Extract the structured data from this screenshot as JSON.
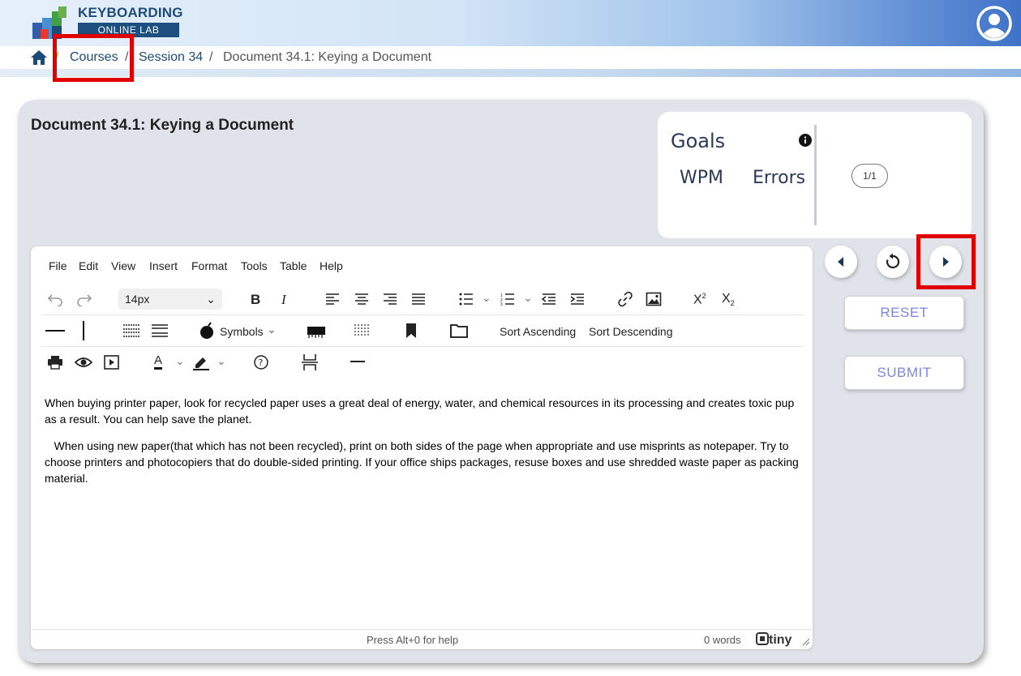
{
  "header": {
    "logo_title": "KEYBOARDING",
    "logo_subtitle": "ONLINE LAB"
  },
  "breadcrumb": {
    "courses": "Courses",
    "sep1": "/",
    "session": "Session 34",
    "sep2": "/",
    "current": "Document 34.1: Keying a Document"
  },
  "main": {
    "doc_title": "Document 34.1: Keying a Document"
  },
  "goals": {
    "title": "Goals",
    "wpm_label": "WPM",
    "errors_label": "Errors",
    "pager": "1/1"
  },
  "actions": {
    "reset": "RESET",
    "submit": "SUBMIT"
  },
  "editor": {
    "menu": [
      "File",
      "Edit",
      "View",
      "Insert",
      "Format",
      "Tools",
      "Table",
      "Help"
    ],
    "font_size": "14px",
    "symbols_label": "Symbols",
    "sort_ascending": "Sort Ascending",
    "sort_descending": "Sort Descending",
    "paragraph1": "When buying printer paper, look for recycled paper uses a great deal of energy, water, and chemical resources in its processing and creates toxic pup as a result. You can help save the planet.",
    "paragraph2": "   When using new paper(that which has not been recycled), print on both sides of the page when appropriate and use misprints as notepaper. Try to choose printers and photocopiers that do double-sided printing. If your office ships packages, resuse boxes and use shredded waste paper as packing material.",
    "status_help": "Press Alt+0 for help",
    "word_count": "0 words",
    "brand": "tiny"
  },
  "colors": {
    "accent": "#7b86e0",
    "header_text": "#1d4c7a",
    "highlight": "#e00000",
    "panel": "#e0e3e9"
  }
}
